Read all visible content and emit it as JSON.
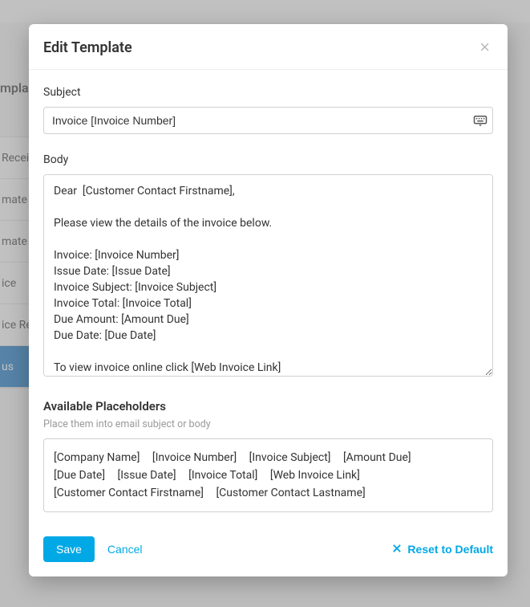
{
  "background": {
    "heading": "mpla",
    "items": [
      "Recei",
      "mate",
      "mate",
      "ice",
      "ice Re",
      "us"
    ]
  },
  "modal": {
    "title": "Edit Template",
    "subject": {
      "label": "Subject",
      "value": "Invoice [Invoice Number]"
    },
    "body": {
      "label": "Body",
      "value": "Dear  [Customer Contact Firstname],\n\nPlease view the details of the invoice below.\n\nInvoice: [Invoice Number]\nIssue Date: [Issue Date]\nInvoice Subject: [Invoice Subject]\nInvoice Total: [Invoice Total]\nDue Amount: [Amount Due]\nDue Date: [Due Date]\n\nTo view invoice online click [Web Invoice Link]"
    },
    "placeholders": {
      "title": "Available Placeholders",
      "subtitle": "Place them into email subject or body",
      "items": [
        "[Company Name]",
        "[Invoice Number]",
        "[Invoice Subject]",
        "[Amount Due]",
        "[Due Date]",
        "[Issue Date]",
        "[Invoice Total]",
        "[Web Invoice Link]",
        "[Customer Contact Firstname]",
        "[Customer Contact Lastname]"
      ]
    },
    "buttons": {
      "save": "Save",
      "cancel": "Cancel",
      "reset": "Reset to Default"
    }
  }
}
